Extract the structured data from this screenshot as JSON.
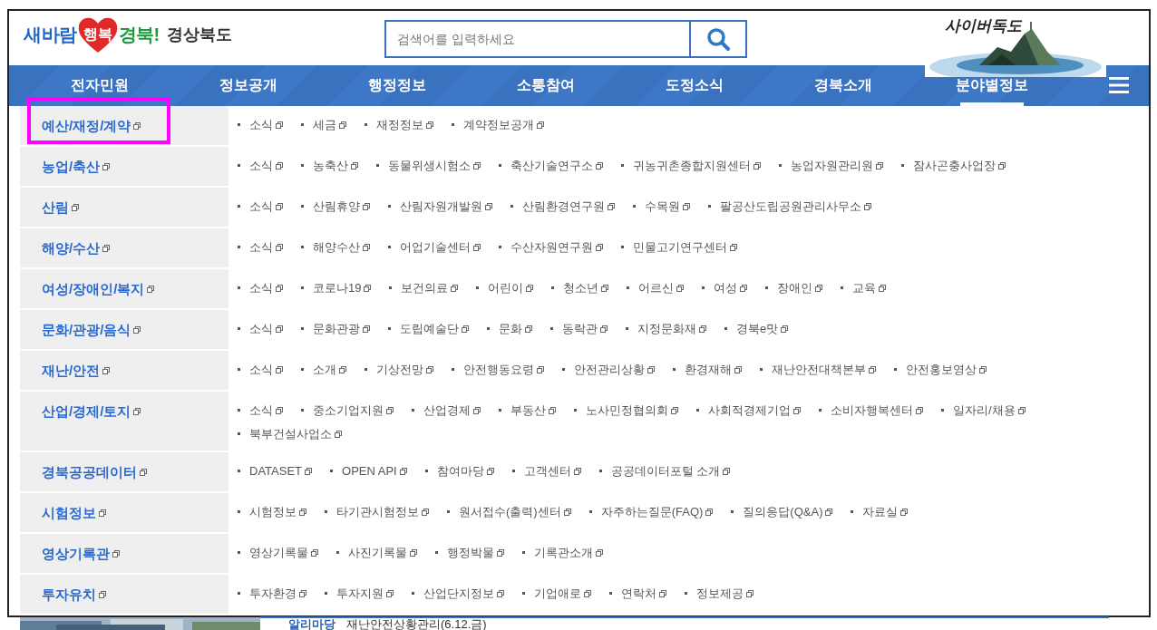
{
  "header": {
    "logo": {
      "part_1": "새바람",
      "part_2": "행복",
      "part_3": "경북!",
      "part_4": "경상북도"
    },
    "search": {
      "placeholder": "검색어를 입력하세요"
    },
    "banner": {
      "label": "사이버독도"
    }
  },
  "nav": {
    "items": [
      {
        "label": "전자민원",
        "selected": false
      },
      {
        "label": "정보공개",
        "selected": false
      },
      {
        "label": "행정정보",
        "selected": false
      },
      {
        "label": "소통참여",
        "selected": false
      },
      {
        "label": "도정소식",
        "selected": false
      },
      {
        "label": "경북소개",
        "selected": false
      },
      {
        "label": "분야별정보",
        "selected": true
      }
    ]
  },
  "categories": [
    {
      "label": "예산/재정/계약",
      "highlighted": true,
      "links": [
        "소식",
        "세금",
        "재정정보",
        "계약정보공개"
      ]
    },
    {
      "label": "농업/축산",
      "highlighted": false,
      "links": [
        "소식",
        "농축산",
        "동물위생시험소",
        "축산기술연구소",
        "귀농귀촌종합지원센터",
        "농업자원관리원",
        "잠사곤충사업장"
      ]
    },
    {
      "label": "산림",
      "highlighted": false,
      "links": [
        "소식",
        "산림휴양",
        "산림자원개발원",
        "산림환경연구원",
        "수목원",
        "팔공산도립공원관리사무소"
      ]
    },
    {
      "label": "해양/수산",
      "highlighted": false,
      "links": [
        "소식",
        "해양수산",
        "어업기술센터",
        "수산자원연구원",
        "민물고기연구센터"
      ]
    },
    {
      "label": "여성/장애인/복지",
      "highlighted": false,
      "links": [
        "소식",
        "코로나19",
        "보건의료",
        "어린이",
        "청소년",
        "어르신",
        "여성",
        "장애인",
        "교육"
      ]
    },
    {
      "label": "문화/관광/음식",
      "highlighted": false,
      "links": [
        "소식",
        "문화관광",
        "도립예술단",
        "문화",
        "동락관",
        "지정문화재",
        "경북e맛"
      ]
    },
    {
      "label": "재난/안전",
      "highlighted": false,
      "links": [
        "소식",
        "소개",
        "기상전망",
        "안전행동요령",
        "안전관리상황",
        "환경재해",
        "재난안전대책본부",
        "안전홍보영상"
      ]
    },
    {
      "label": "산업/경제/토지",
      "highlighted": false,
      "links": [
        "소식",
        "중소기업지원",
        "산업경제",
        "부동산",
        "노사민정협의회",
        "사회적경제기업",
        "소비자행복센터",
        "일자리/채용",
        "북부건설사업소"
      ]
    },
    {
      "label": "경북공공데이터",
      "highlighted": false,
      "links": [
        "DATASET",
        "OPEN API",
        "참여마당",
        "고객센터",
        "공공데이터포털 소개"
      ]
    },
    {
      "label": "시험정보",
      "highlighted": false,
      "links": [
        "시험정보",
        "타기관시험정보",
        "원서접수(출력)센터",
        "자주하는질문(FAQ)",
        "질의응답(Q&A)",
        "자료실"
      ]
    },
    {
      "label": "영상기록관",
      "highlighted": false,
      "links": [
        "영상기록물",
        "사진기록물",
        "행정박물",
        "기록관소개"
      ]
    },
    {
      "label": "투자유치",
      "highlighted": false,
      "links": [
        "투자환경",
        "투자지원",
        "산업단지정보",
        "기업애로",
        "연락처",
        "정보제공"
      ]
    }
  ],
  "behind": {
    "heading": "알리마당",
    "headline": "재난안전상황관리(6.12.금)"
  }
}
